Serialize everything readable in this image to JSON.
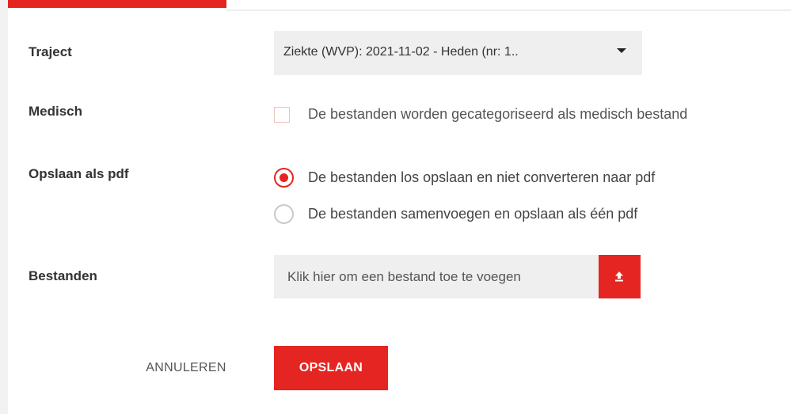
{
  "colors": {
    "accent": "#e52521",
    "field_background": "#efefef",
    "label_text": "#333333"
  },
  "form": {
    "traject": {
      "label": "Traject",
      "selected_value": "Ziekte (WVP): 2021-11-02 - Heden (nr: 1..",
      "icon": "caret-down-icon"
    },
    "medisch": {
      "label": "Medisch",
      "checkbox_label": "De bestanden worden gecategoriseerd als medisch bestand",
      "checked": false
    },
    "opslaan_als_pdf": {
      "label": "Opslaan als pdf",
      "options": [
        {
          "label": "De bestanden los opslaan en niet converteren naar pdf",
          "selected": true
        },
        {
          "label": "De bestanden samenvoegen en opslaan als één pdf",
          "selected": false
        }
      ]
    },
    "bestanden": {
      "label": "Bestanden",
      "placeholder": "Klik hier om een bestand toe te voegen",
      "upload_icon": "upload-icon"
    }
  },
  "actions": {
    "cancel_label": "ANNULEREN",
    "save_label": "OPSLAAN"
  }
}
